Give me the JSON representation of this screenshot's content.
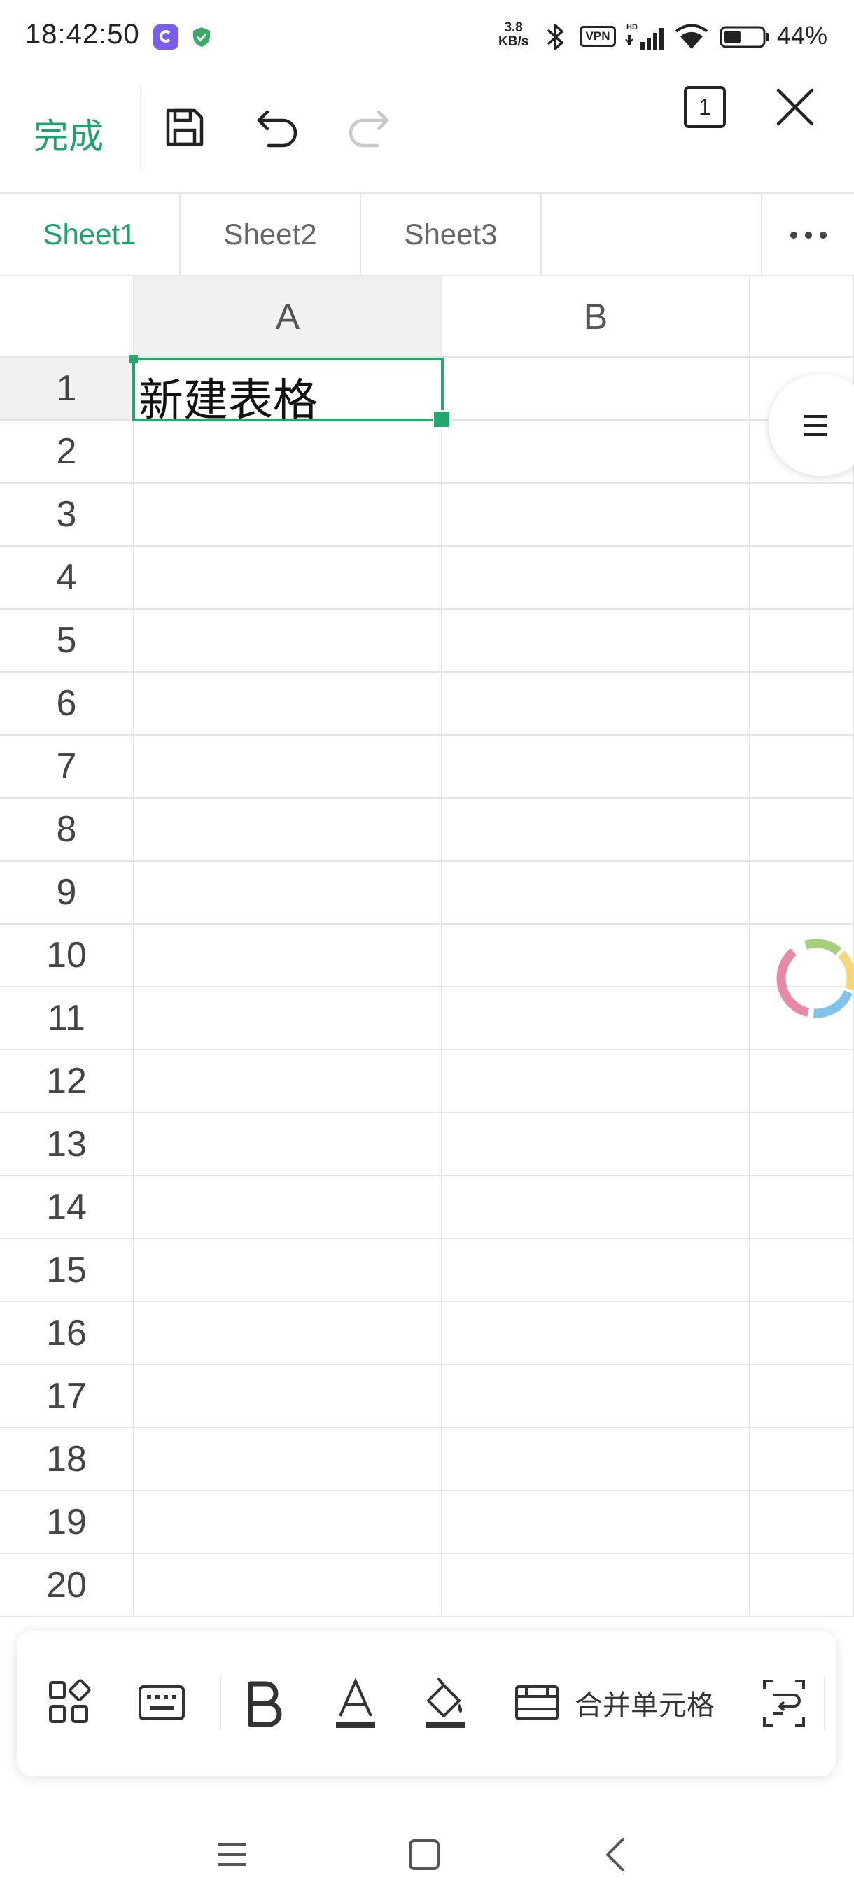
{
  "status_bar": {
    "time": "18:42:50",
    "net_speed_value": "3.8",
    "net_speed_unit": "KB/s",
    "vpn_label": "VPN",
    "hd_label": "HD",
    "battery_percent": "44%",
    "battery_level": 0.44
  },
  "toolbar": {
    "done_label": "完成",
    "sheet_count": "1",
    "save_icon": "save-icon",
    "undo_icon": "undo-icon",
    "redo_icon": "redo-icon",
    "close_icon": "close-icon"
  },
  "sheet_tabs": {
    "tabs": [
      {
        "label": "Sheet1",
        "active": true
      },
      {
        "label": "Sheet2",
        "active": false
      },
      {
        "label": "Sheet3",
        "active": false
      }
    ],
    "more_icon": "more-dots-icon"
  },
  "grid": {
    "columns": [
      "A",
      "B"
    ],
    "rows": [
      "1",
      "2",
      "3",
      "4",
      "5",
      "6",
      "7",
      "8",
      "9",
      "10",
      "11",
      "12",
      "13",
      "14",
      "15",
      "16",
      "17",
      "18",
      "19",
      "20"
    ],
    "cells": {
      "A1": "新建表格"
    },
    "selected_cell": "A1"
  },
  "format_bar": {
    "merge_label": "合并单元格",
    "icons": [
      "apps-grid-icon",
      "keyboard-icon",
      "bold-icon",
      "font-color-icon",
      "fill-color-icon",
      "merge-cells-icon",
      "wrap-text-icon"
    ]
  },
  "colors": {
    "accent": "#1aa36a",
    "gridline": "#e6e6e6",
    "header_selected": "#f1f1f1"
  }
}
